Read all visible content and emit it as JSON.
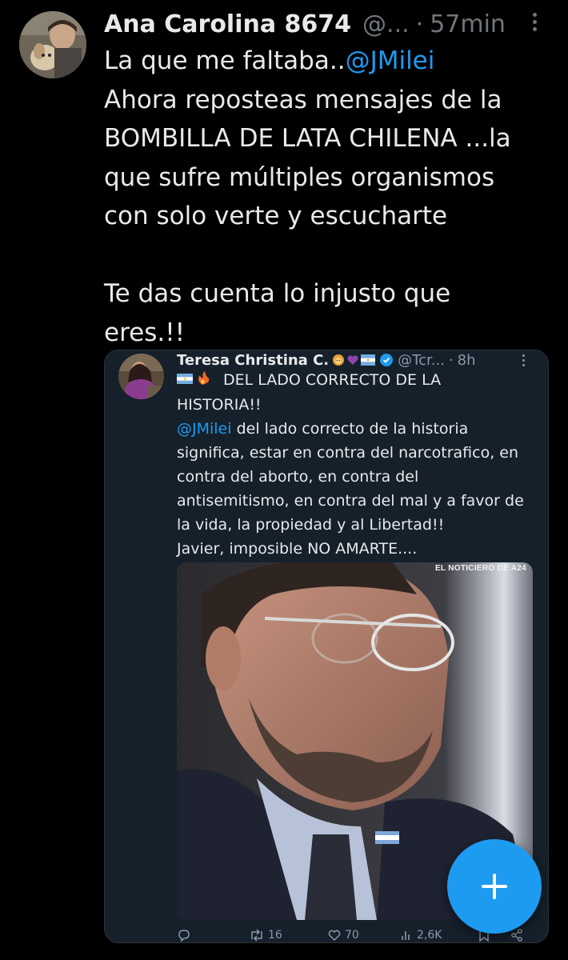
{
  "post": {
    "display_name": "Ana Carolina 8674",
    "handle": "@...",
    "separator": "·",
    "time": "57min",
    "text_before_mention": "La que me faltaba..",
    "mention": "@JMilei",
    "text_after_mention": "\nAhora reposteas mensajes de la\nBOMBILLA DE LATA CHILENA ...la\nque sufre múltiples organismos\ncon solo verte y escucharte\n\nTe das cuenta lo injusto que\neres.!!"
  },
  "quoted_post": {
    "display_name": "Teresa Christina C.",
    "handle": "@Tcr...",
    "separator": "·",
    "time": "8h",
    "line1_text": "DEL LADO CORRECTO DE LA\nHISTORIA!!",
    "mention": "@JMilei",
    "body_text": " del lado correcto de la historia\nsignifica, estar en contra del narcotrafico, en\ncontra del aborto, en contra del\nantisemitismo, en contra del mal y a favor de\nla vida, la propiedad y al Libertad!!\nJavier, imposible NO AMARTE....",
    "media_watermark": "EL NOTICIERO DE A24",
    "actions": {
      "reply": "",
      "repost": "16",
      "like": "70",
      "views": "2,6K"
    }
  },
  "icons": {
    "more": "more-vertical-icon",
    "verified": "verified-badge-icon",
    "reply": "reply-icon",
    "repost": "repost-icon",
    "like": "heart-icon",
    "views": "views-icon",
    "bookmark": "bookmark-icon",
    "share": "share-icon",
    "compose": "plus-icon"
  },
  "colors": {
    "background": "#000000",
    "text": "#e7e9ea",
    "muted": "#71767b",
    "accent": "#1d9bf0",
    "quote_bg": "#15202b"
  }
}
